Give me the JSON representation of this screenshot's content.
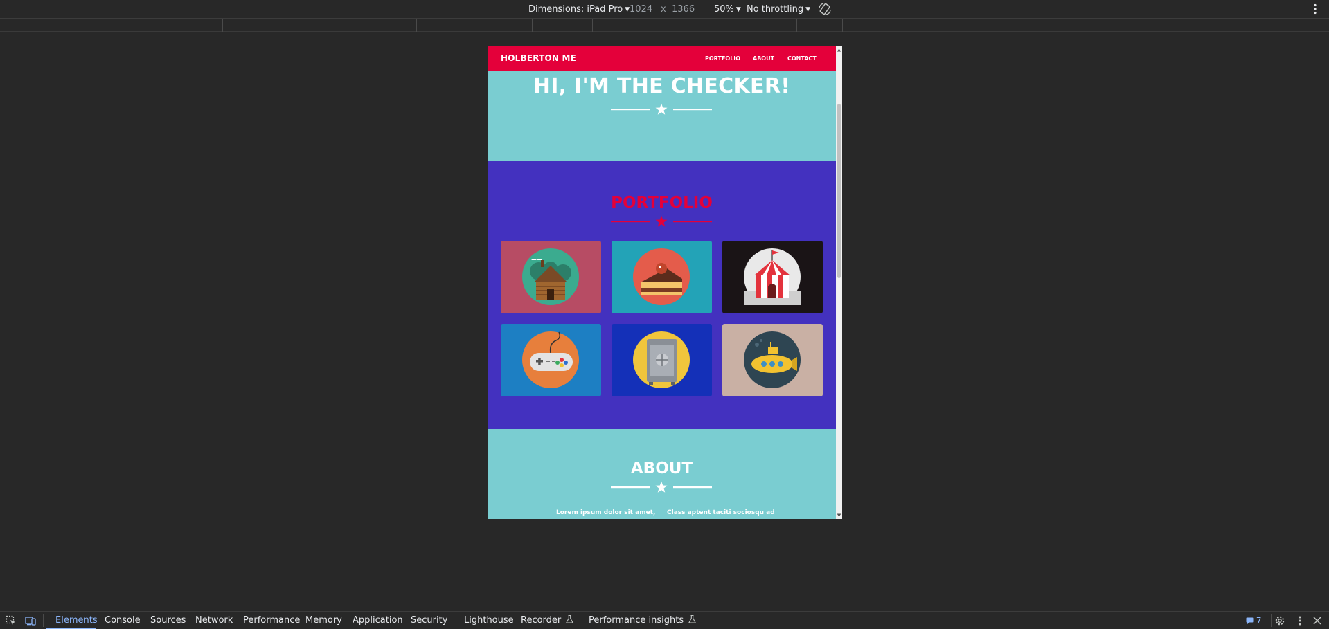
{
  "device_toolbar": {
    "dimensions_label": "Dimensions: iPad Pro",
    "width": "1024",
    "times": "x",
    "height": "1366",
    "zoom": "50%",
    "throttling": "No throttling",
    "icons": [
      "chevron-down-icon",
      "rotate-icon",
      "more-options-icon"
    ]
  },
  "page": {
    "nav": {
      "brand": "HOLBERTON ME",
      "links": [
        "PORTFOLIO",
        "ABOUT",
        "CONTACT"
      ]
    },
    "hero": {
      "title": "HI, I'M THE CHECKER!"
    },
    "portfolio": {
      "title": "PORTFOLIO",
      "tiles": [
        {
          "icon": "cabin-icon",
          "background": "#b74c64"
        },
        {
          "icon": "cake-icon",
          "background": "#23a3b7"
        },
        {
          "icon": "circus-tent-icon",
          "background": "#1a1416"
        },
        {
          "icon": "game-controller-icon",
          "background": "#1d7fc3"
        },
        {
          "icon": "safe-icon",
          "background": "#1430b8"
        },
        {
          "icon": "submarine-icon",
          "background": "#c9b0a4"
        }
      ]
    },
    "about": {
      "title": "ABOUT",
      "col1": "Lorem ipsum dolor sit amet,",
      "col2": "Class aptent taciti sociosqu ad"
    },
    "colors": {
      "nav": "#e4003a",
      "hero": "#7acdd1",
      "portfolio": "#4331bf",
      "accent": "#e4003a"
    }
  },
  "devtools": {
    "tabs": [
      "Elements",
      "Console",
      "Sources",
      "Network",
      "Performance",
      "Memory",
      "Application",
      "Security",
      "Lighthouse",
      "Recorder",
      "Performance insights"
    ],
    "active_tab": "Elements",
    "issues_count": "7",
    "icons": [
      "inspect-element-icon",
      "device-toggle-icon",
      "experiment-flask-icon",
      "issues-icon",
      "settings-icon",
      "more-options-icon",
      "close-icon"
    ]
  }
}
